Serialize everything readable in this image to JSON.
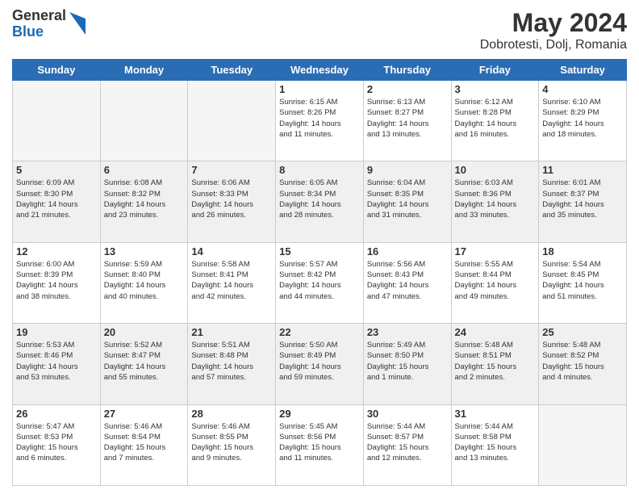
{
  "header": {
    "logo_general": "General",
    "logo_blue": "Blue",
    "title": "May 2024",
    "subtitle": "Dobrotesti, Dolj, Romania"
  },
  "weekdays": [
    "Sunday",
    "Monday",
    "Tuesday",
    "Wednesday",
    "Thursday",
    "Friday",
    "Saturday"
  ],
  "weeks": [
    [
      {
        "day": "",
        "info": ""
      },
      {
        "day": "",
        "info": ""
      },
      {
        "day": "",
        "info": ""
      },
      {
        "day": "1",
        "info": "Sunrise: 6:15 AM\nSunset: 8:26 PM\nDaylight: 14 hours\nand 11 minutes."
      },
      {
        "day": "2",
        "info": "Sunrise: 6:13 AM\nSunset: 8:27 PM\nDaylight: 14 hours\nand 13 minutes."
      },
      {
        "day": "3",
        "info": "Sunrise: 6:12 AM\nSunset: 8:28 PM\nDaylight: 14 hours\nand 16 minutes."
      },
      {
        "day": "4",
        "info": "Sunrise: 6:10 AM\nSunset: 8:29 PM\nDaylight: 14 hours\nand 18 minutes."
      }
    ],
    [
      {
        "day": "5",
        "info": "Sunrise: 6:09 AM\nSunset: 8:30 PM\nDaylight: 14 hours\nand 21 minutes."
      },
      {
        "day": "6",
        "info": "Sunrise: 6:08 AM\nSunset: 8:32 PM\nDaylight: 14 hours\nand 23 minutes."
      },
      {
        "day": "7",
        "info": "Sunrise: 6:06 AM\nSunset: 8:33 PM\nDaylight: 14 hours\nand 26 minutes."
      },
      {
        "day": "8",
        "info": "Sunrise: 6:05 AM\nSunset: 8:34 PM\nDaylight: 14 hours\nand 28 minutes."
      },
      {
        "day": "9",
        "info": "Sunrise: 6:04 AM\nSunset: 8:35 PM\nDaylight: 14 hours\nand 31 minutes."
      },
      {
        "day": "10",
        "info": "Sunrise: 6:03 AM\nSunset: 8:36 PM\nDaylight: 14 hours\nand 33 minutes."
      },
      {
        "day": "11",
        "info": "Sunrise: 6:01 AM\nSunset: 8:37 PM\nDaylight: 14 hours\nand 35 minutes."
      }
    ],
    [
      {
        "day": "12",
        "info": "Sunrise: 6:00 AM\nSunset: 8:39 PM\nDaylight: 14 hours\nand 38 minutes."
      },
      {
        "day": "13",
        "info": "Sunrise: 5:59 AM\nSunset: 8:40 PM\nDaylight: 14 hours\nand 40 minutes."
      },
      {
        "day": "14",
        "info": "Sunrise: 5:58 AM\nSunset: 8:41 PM\nDaylight: 14 hours\nand 42 minutes."
      },
      {
        "day": "15",
        "info": "Sunrise: 5:57 AM\nSunset: 8:42 PM\nDaylight: 14 hours\nand 44 minutes."
      },
      {
        "day": "16",
        "info": "Sunrise: 5:56 AM\nSunset: 8:43 PM\nDaylight: 14 hours\nand 47 minutes."
      },
      {
        "day": "17",
        "info": "Sunrise: 5:55 AM\nSunset: 8:44 PM\nDaylight: 14 hours\nand 49 minutes."
      },
      {
        "day": "18",
        "info": "Sunrise: 5:54 AM\nSunset: 8:45 PM\nDaylight: 14 hours\nand 51 minutes."
      }
    ],
    [
      {
        "day": "19",
        "info": "Sunrise: 5:53 AM\nSunset: 8:46 PM\nDaylight: 14 hours\nand 53 minutes."
      },
      {
        "day": "20",
        "info": "Sunrise: 5:52 AM\nSunset: 8:47 PM\nDaylight: 14 hours\nand 55 minutes."
      },
      {
        "day": "21",
        "info": "Sunrise: 5:51 AM\nSunset: 8:48 PM\nDaylight: 14 hours\nand 57 minutes."
      },
      {
        "day": "22",
        "info": "Sunrise: 5:50 AM\nSunset: 8:49 PM\nDaylight: 14 hours\nand 59 minutes."
      },
      {
        "day": "23",
        "info": "Sunrise: 5:49 AM\nSunset: 8:50 PM\nDaylight: 15 hours\nand 1 minute."
      },
      {
        "day": "24",
        "info": "Sunrise: 5:48 AM\nSunset: 8:51 PM\nDaylight: 15 hours\nand 2 minutes."
      },
      {
        "day": "25",
        "info": "Sunrise: 5:48 AM\nSunset: 8:52 PM\nDaylight: 15 hours\nand 4 minutes."
      }
    ],
    [
      {
        "day": "26",
        "info": "Sunrise: 5:47 AM\nSunset: 8:53 PM\nDaylight: 15 hours\nand 6 minutes."
      },
      {
        "day": "27",
        "info": "Sunrise: 5:46 AM\nSunset: 8:54 PM\nDaylight: 15 hours\nand 7 minutes."
      },
      {
        "day": "28",
        "info": "Sunrise: 5:46 AM\nSunset: 8:55 PM\nDaylight: 15 hours\nand 9 minutes."
      },
      {
        "day": "29",
        "info": "Sunrise: 5:45 AM\nSunset: 8:56 PM\nDaylight: 15 hours\nand 11 minutes."
      },
      {
        "day": "30",
        "info": "Sunrise: 5:44 AM\nSunset: 8:57 PM\nDaylight: 15 hours\nand 12 minutes."
      },
      {
        "day": "31",
        "info": "Sunrise: 5:44 AM\nSunset: 8:58 PM\nDaylight: 15 hours\nand 13 minutes."
      },
      {
        "day": "",
        "info": ""
      }
    ]
  ]
}
